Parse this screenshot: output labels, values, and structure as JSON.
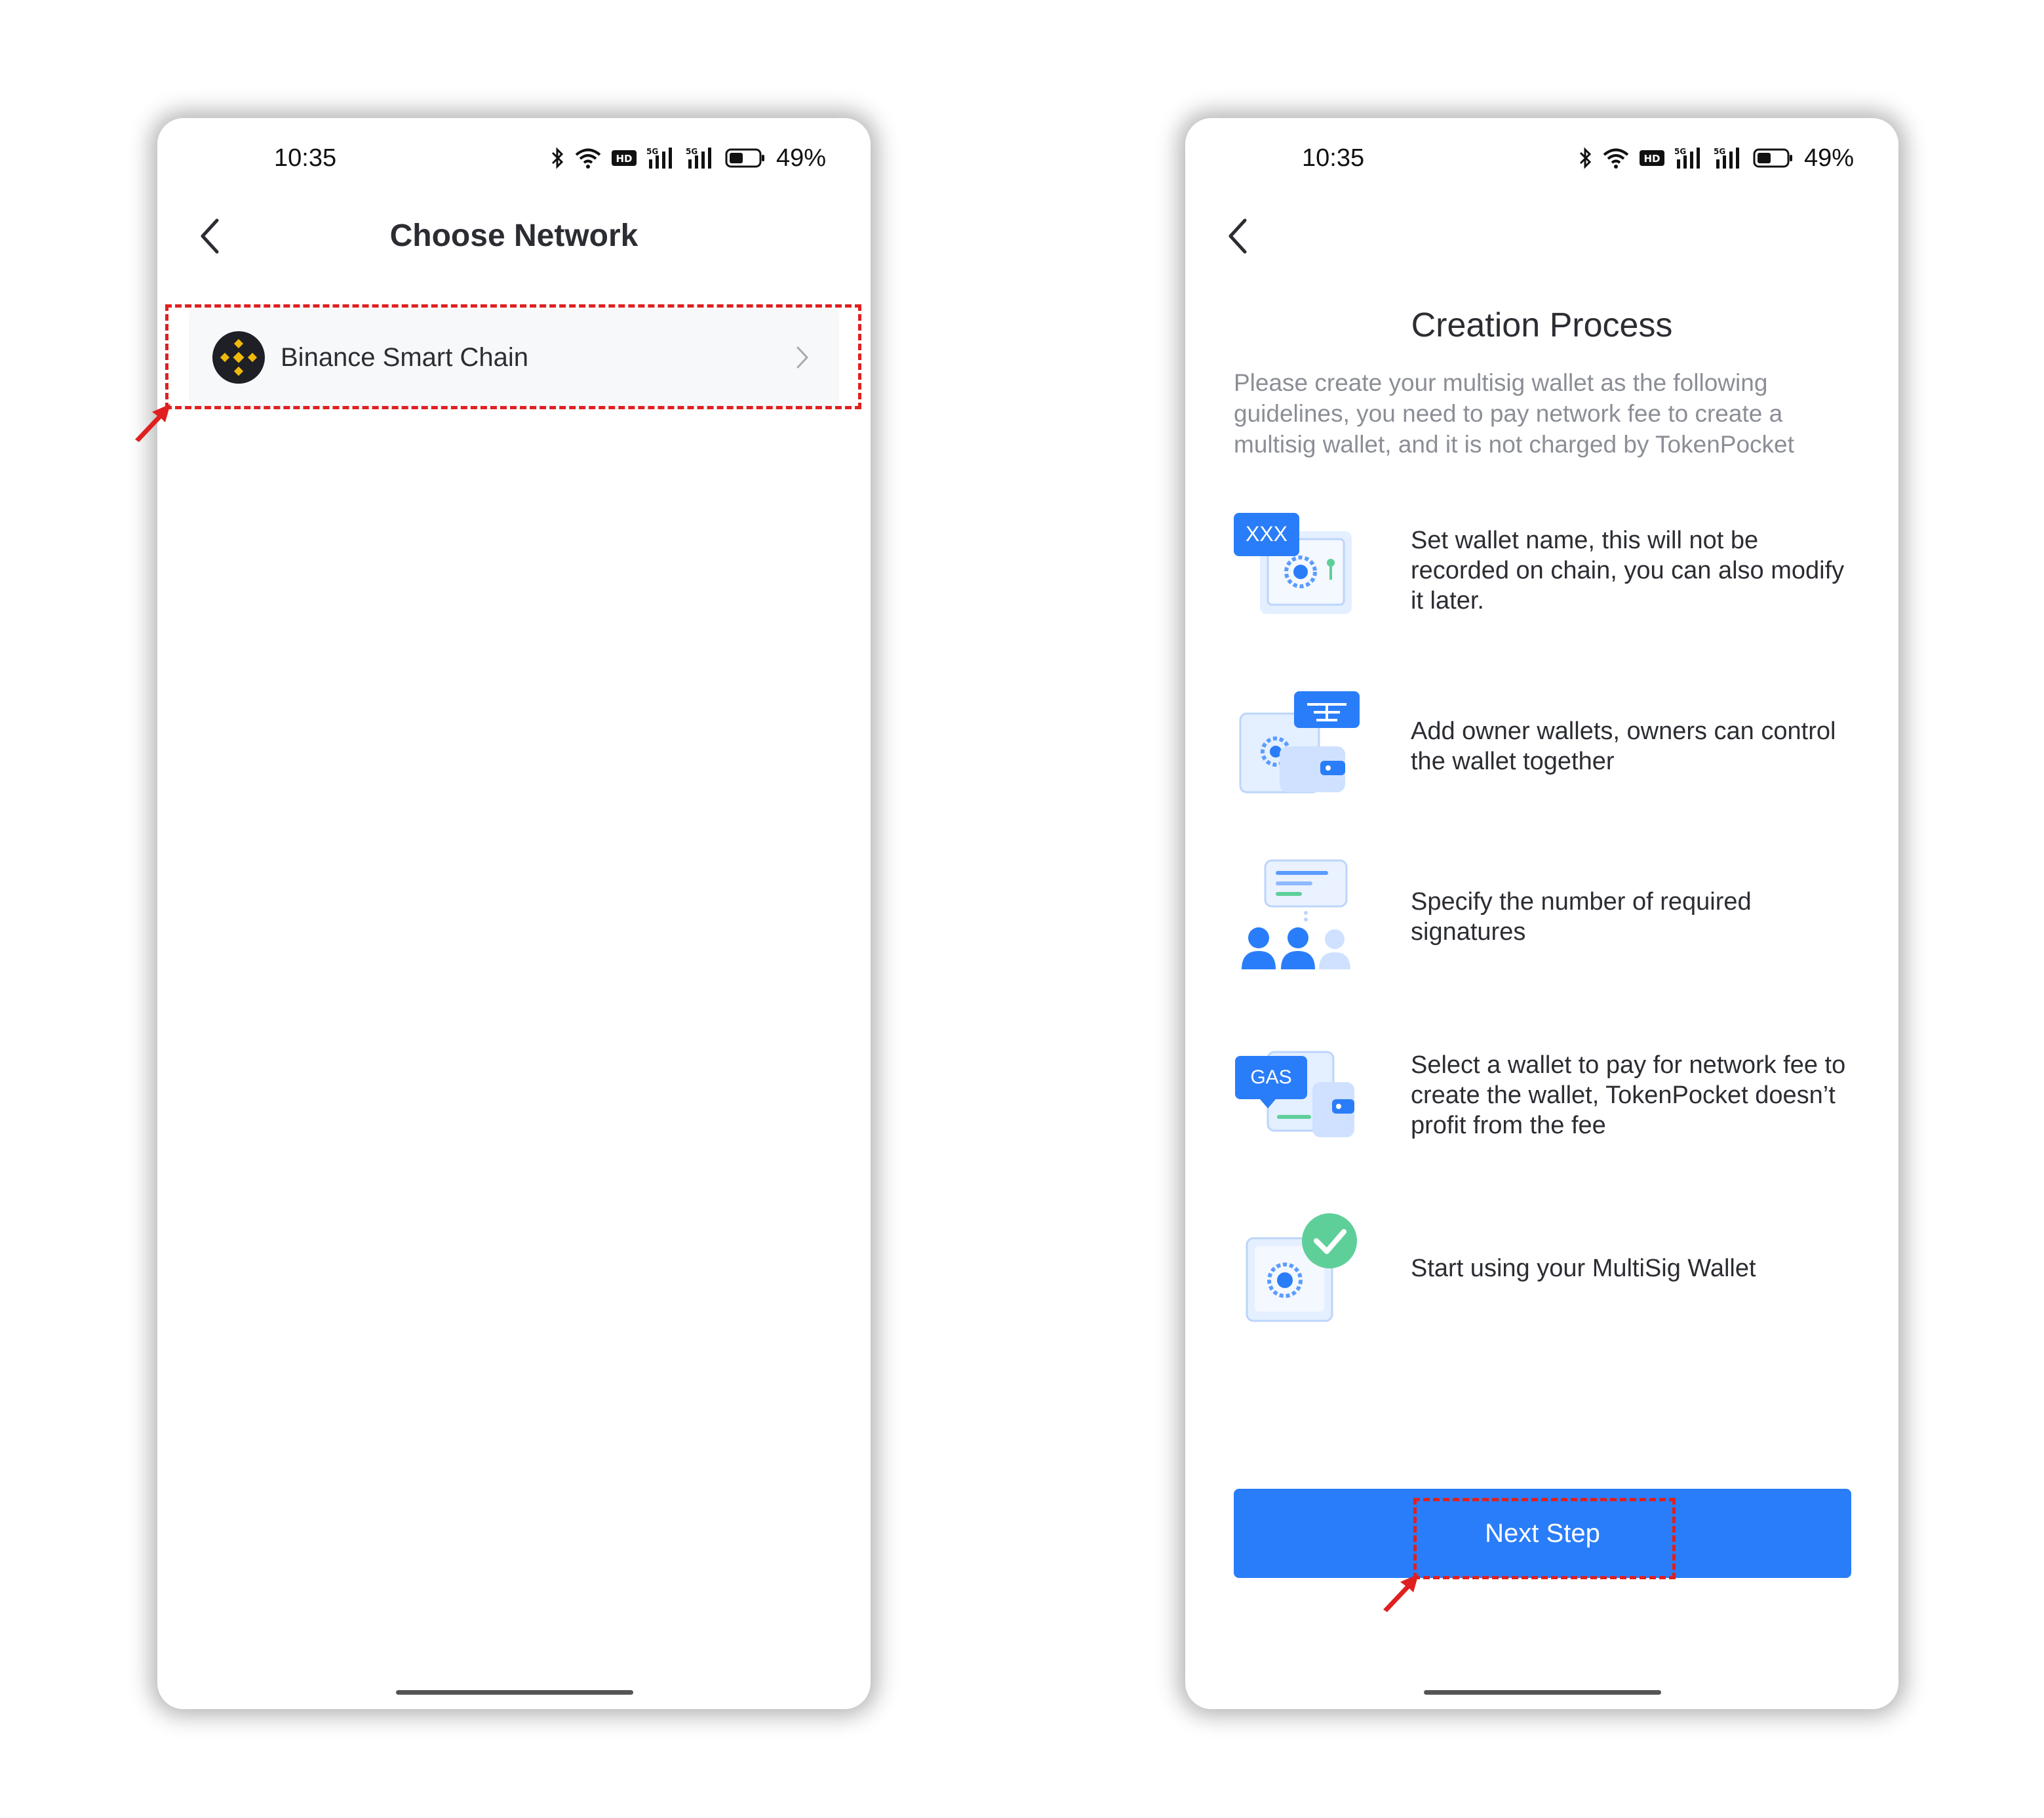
{
  "left_screen": {
    "status_bar": {
      "time": "10:35",
      "battery": "49%"
    },
    "title": "Choose Network",
    "networks": [
      {
        "name": "Binance Smart Chain",
        "icon": "binance-logo-icon"
      }
    ]
  },
  "right_screen": {
    "status_bar": {
      "time": "10:35",
      "battery": "49%"
    },
    "title": "Creation Process",
    "description": "Please create your multisig wallet as the following guidelines, you need to pay network fee to create a multisig wallet, and it is not charged by TokenPocket",
    "steps": [
      {
        "text": "Set wallet name, this will not be recorded on chain, you can also modify it later.",
        "icon": "wallet-name-icon",
        "badge": "XXX"
      },
      {
        "text": "Add owner wallets, owners can control the wallet together",
        "icon": "owner-wallets-icon"
      },
      {
        "text": "Specify the number of required signatures",
        "icon": "signatures-icon"
      },
      {
        "text": "Select a wallet to pay for network fee to create the wallet, TokenPocket doesn’t profit from the fee",
        "icon": "gas-fee-icon",
        "badge": "GAS"
      },
      {
        "text": "Start using your MultiSig Wallet",
        "icon": "wallet-ready-icon"
      }
    ],
    "next_button": "Next Step"
  },
  "colors": {
    "primary": "#2a7df8",
    "annotation": "#e02020",
    "binance_yellow": "#f0b90b"
  }
}
